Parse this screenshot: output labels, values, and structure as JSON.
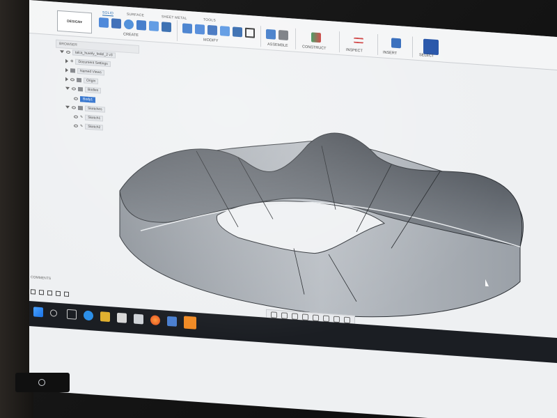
{
  "toolbar": {
    "workspace": "DESIGN",
    "tabs": [
      "SOLID",
      "SURFACE",
      "SHEET METAL",
      "TOOLS"
    ],
    "groups": [
      "CREATE",
      "MODIFY",
      "ASSEMBLE",
      "CONSTRUCT",
      "INSPECT",
      "INSERT",
      "SELECT"
    ]
  },
  "browser": {
    "title": "BROWSER",
    "document": "talca_huvely_fedel_2 v3",
    "nodes": [
      "Document Settings",
      "Named Views",
      "Origin",
      "Bodies",
      "Body1",
      "Sketches",
      "Sketch1",
      "Sketch2"
    ]
  },
  "comments_label": "COMMENTS",
  "colors": {
    "accent": "#1f66c9",
    "model": "#9fa5ac"
  }
}
